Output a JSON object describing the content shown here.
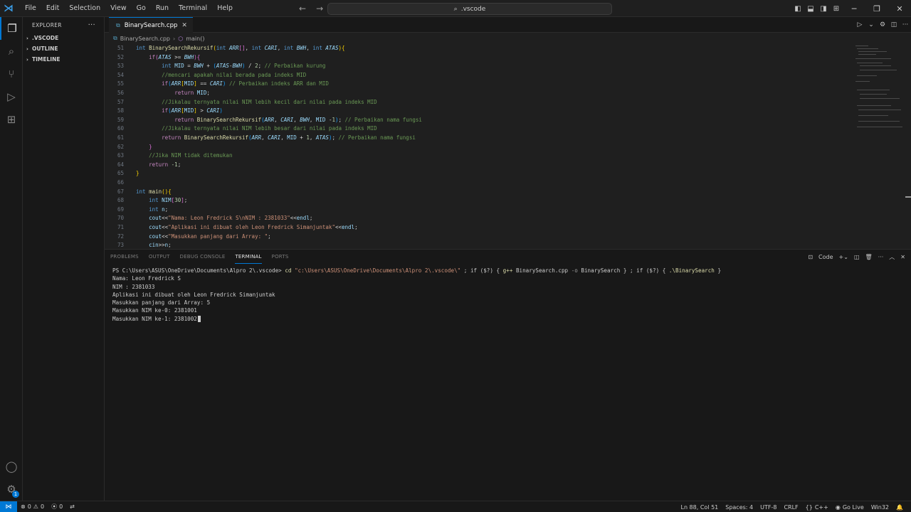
{
  "menu": [
    "File",
    "Edit",
    "Selection",
    "View",
    "Go",
    "Run",
    "Terminal",
    "Help"
  ],
  "command_center": {
    "text": ".vscode"
  },
  "sidebar": {
    "title": "EXPLORER",
    "sections": [
      ".VSCODE",
      "OUTLINE",
      "TIMELINE"
    ]
  },
  "tab": {
    "label": "BinarySearch.cpp"
  },
  "breadcrumb": {
    "file": "BinarySearch.cpp",
    "symbol": "main()"
  },
  "code": {
    "line_numbers": [
      "51",
      "52",
      "53",
      "54",
      "55",
      "56",
      "57",
      "58",
      "59",
      "60",
      "61",
      "62",
      "63",
      "64",
      "65",
      "66",
      "67",
      "68",
      "69",
      "70",
      "71",
      "72",
      "73"
    ]
  },
  "panel": {
    "tabs": [
      "PROBLEMS",
      "OUTPUT",
      "DEBUG CONSOLE",
      "TERMINAL",
      "PORTS"
    ],
    "shell_label": "Code",
    "terminal_lines": [
      "Nama: Leon Fredrick S",
      "NIM : 2381033",
      "Aplikasi ini dibuat oleh Leon Fredrick Simanjuntak",
      "Masukkan panjang dari Array: 5",
      "Masukkan NIM ke-0: 2381001"
    ],
    "prompt": "PS C:\\Users\\ASUS\\OneDrive\\Documents\\Alpro 2\\.vscode>",
    "command_cd": "cd",
    "command_path": "\"c:\\Users\\ASUS\\OneDrive\\Documents\\Alpro 2\\.vscode\\\"",
    "command_rest_1": " ; if ($?) { ",
    "command_gpp": "g++",
    "command_rest_2": " BinarySearch.cpp ",
    "command_flag": "-o",
    "command_rest_3": " BinarySearch } ; if ($?) { ",
    "command_run": ".\\BinarySearch",
    "command_rest_4": " }",
    "current_input": "Masukkan NIM ke-1: 2381002"
  },
  "status": {
    "errors": "0",
    "warnings": "0",
    "ports": "0",
    "position": "Ln 88, Col 51",
    "spaces": "Spaces: 4",
    "encoding": "UTF-8",
    "eol": "CRLF",
    "language": "C++",
    "golive": "Go Live",
    "platform": "Win32",
    "settings_badge": "1"
  }
}
